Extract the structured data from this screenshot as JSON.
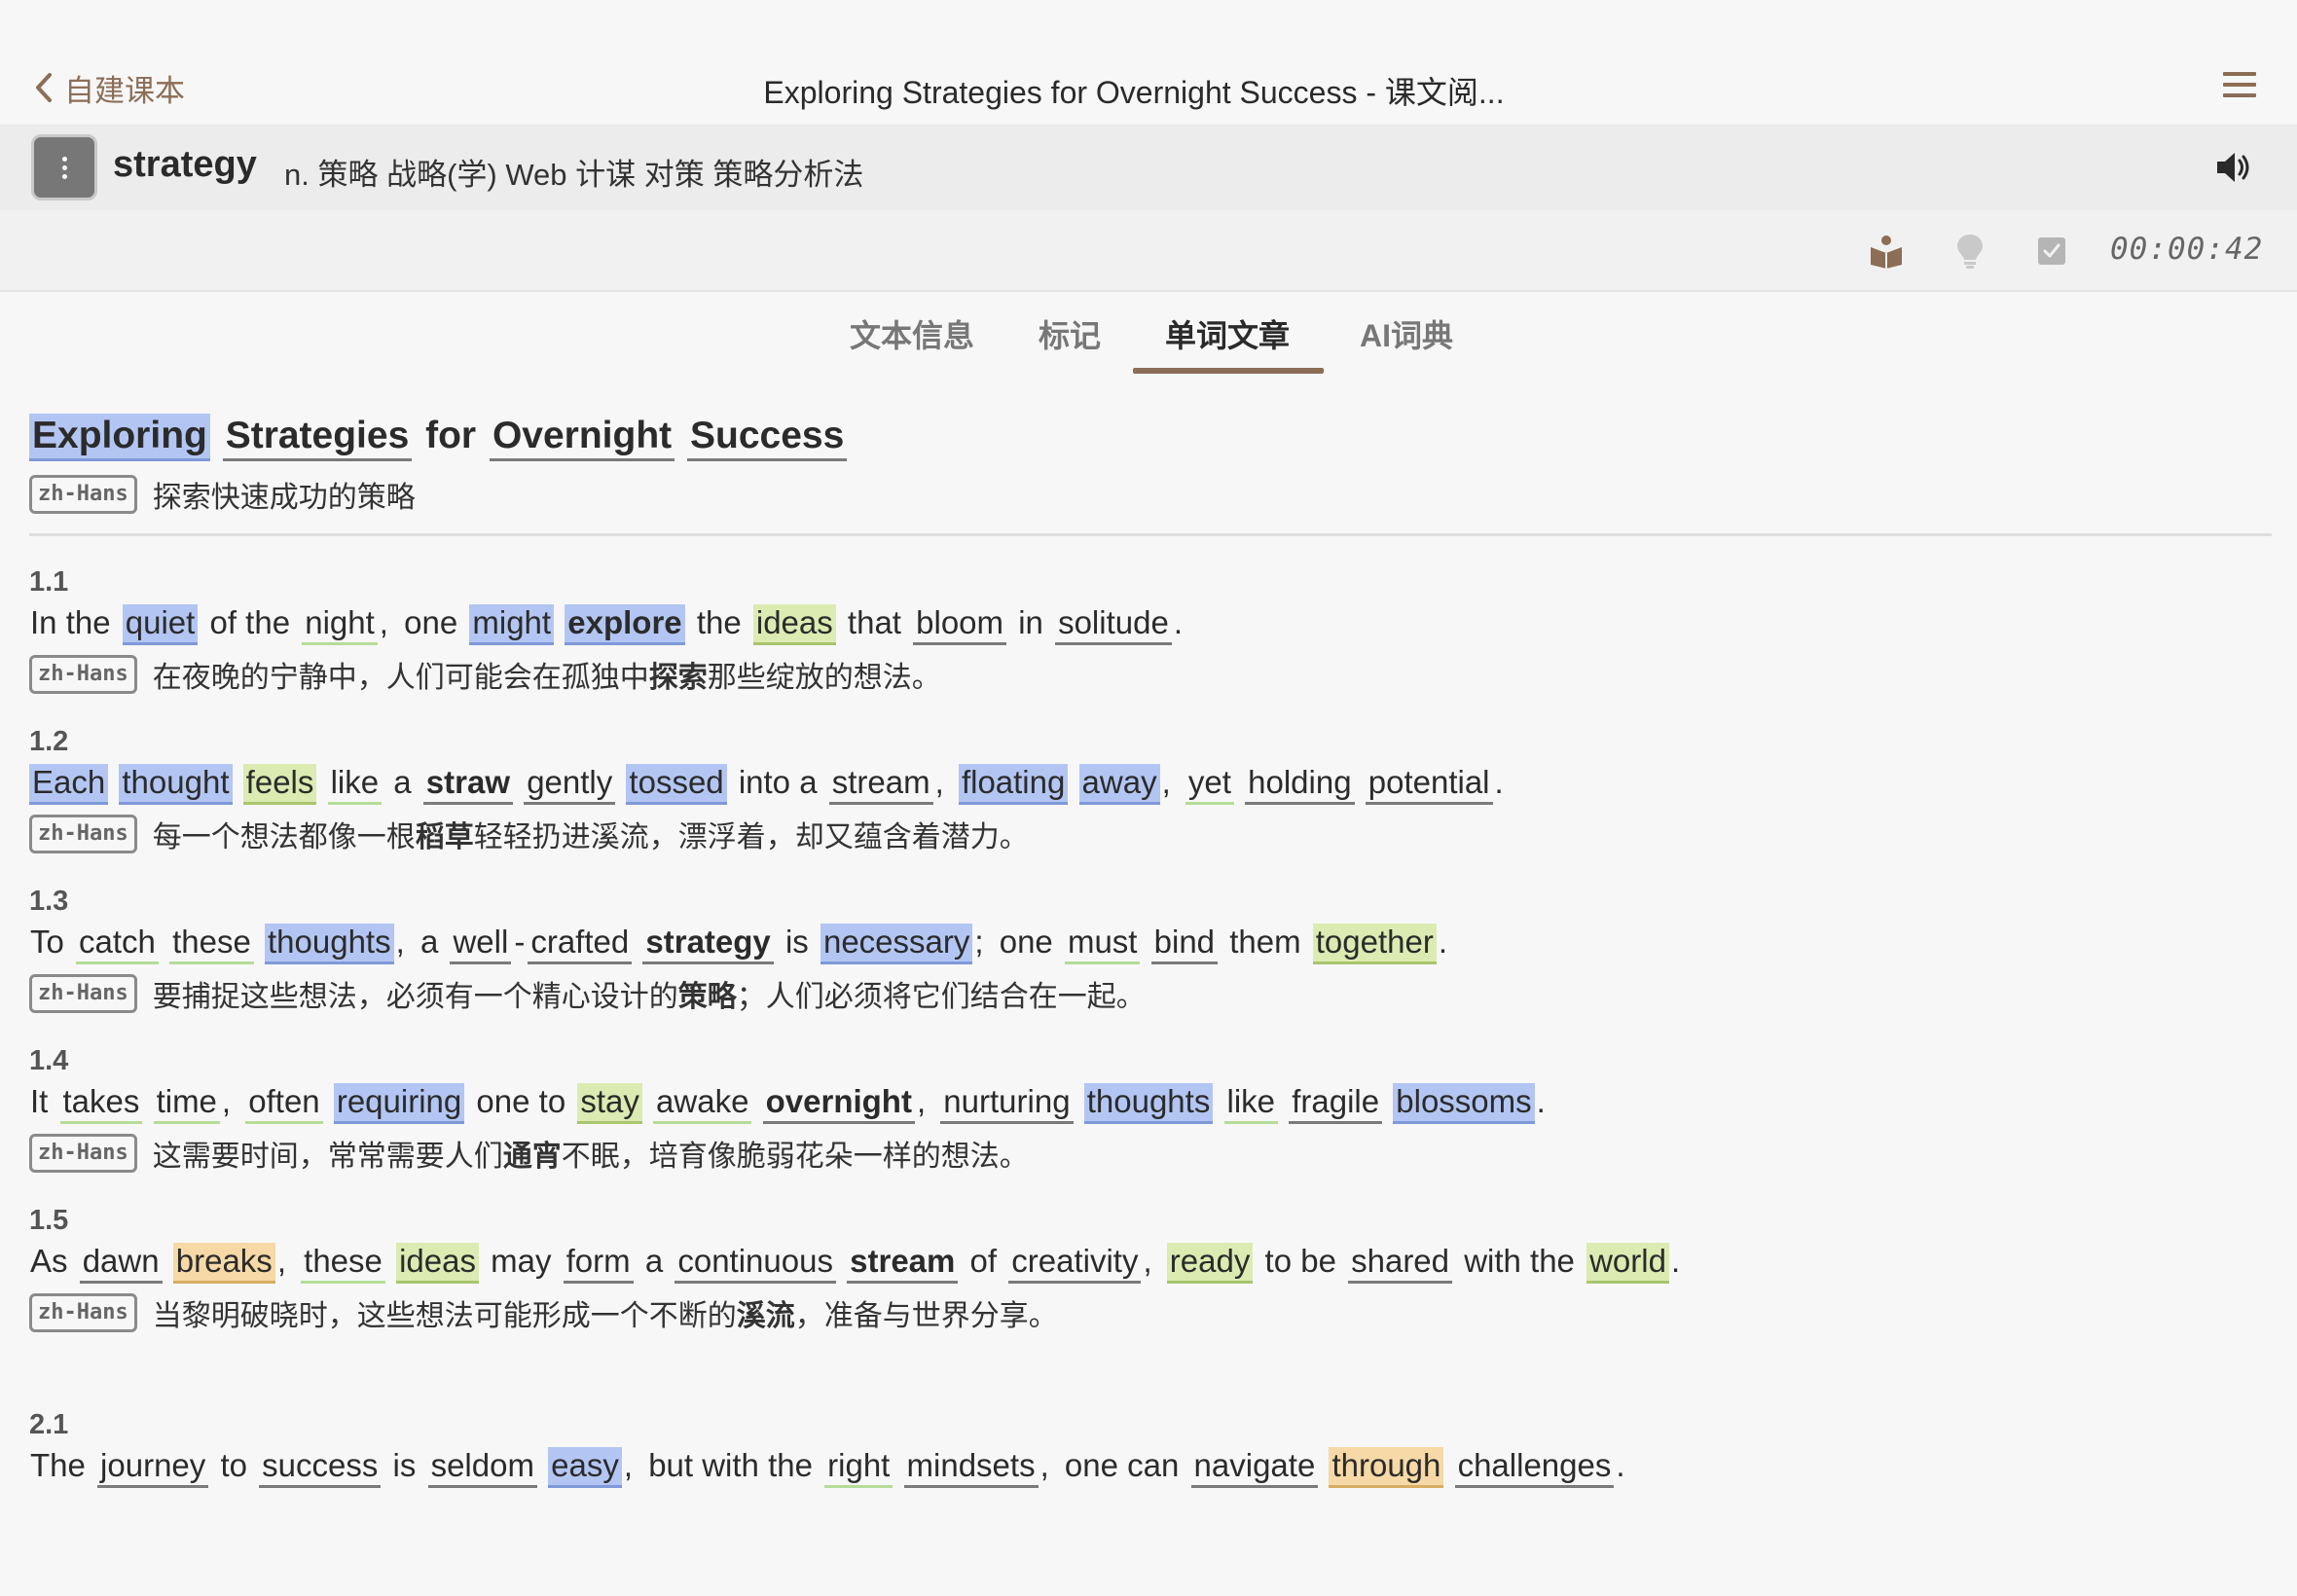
{
  "header": {
    "back_label": "自建课本",
    "title": "Exploring Strategies for Overnight Success - 课文阅..."
  },
  "word": {
    "headword": "strategy",
    "definition": "n. 策略 战略(学) Web 计谋 对策 策略分析法"
  },
  "toolbar": {
    "timer": "00:00:42"
  },
  "tabs": [
    "文本信息",
    "标记",
    "单词文章",
    "AI词典"
  ],
  "active_tab": "单词文章",
  "lang_tag": "zh-Hans",
  "article": {
    "title": [
      "Exploring",
      "Strategies",
      "for",
      "Overnight",
      "Success"
    ],
    "title_translation": "探索快速成功的策略",
    "sentences": [
      {
        "num": "1.1",
        "tokens": [
          "In the",
          "quiet",
          "of the",
          "night",
          ",",
          "one",
          "might",
          "explore",
          "the",
          "ideas",
          "that",
          "bloom",
          "in",
          "solitude",
          "."
        ],
        "translation": [
          "在夜晚的宁静中，人们可能会在孤独中",
          "探索",
          "那些绽放的想法。"
        ]
      },
      {
        "num": "1.2",
        "tokens": [
          "Each",
          "thought",
          "feels",
          "like",
          "a",
          "straw",
          "gently",
          "tossed",
          "into a",
          "stream",
          ",",
          "floating",
          "away",
          ",",
          "yet",
          "holding",
          "potential",
          "."
        ],
        "translation": [
          "每一个想法都像一根",
          "稻草",
          "轻轻扔进溪流，漂浮着，却又蕴含着潜力。"
        ]
      },
      {
        "num": "1.3",
        "tokens": [
          "To",
          "catch",
          "these",
          "thoughts",
          ",",
          "a",
          "well",
          "-",
          "crafted",
          "strategy",
          "is",
          "necessary",
          ";",
          "one",
          "must",
          "bind",
          "them",
          "together",
          "."
        ],
        "translation": [
          "要捕捉这些想法，必须有一个精心设计的",
          "策略",
          "；人们必须将它们结合在一起。"
        ]
      },
      {
        "num": "1.4",
        "tokens": [
          "It",
          "takes",
          "time",
          ",",
          "often",
          "requiring",
          "one to",
          "stay",
          "awake",
          "overnight",
          ",",
          "nurturing",
          "thoughts",
          "like",
          "fragile",
          "blossoms",
          "."
        ],
        "translation": [
          "这需要时间，常常需要人们",
          "通宵",
          "不眠，培育像脆弱花朵一样的想法。"
        ]
      },
      {
        "num": "1.5",
        "tokens": [
          "As",
          "dawn",
          "breaks",
          ",",
          "these",
          "ideas",
          "may",
          "form",
          "a",
          "continuous",
          "stream",
          "of",
          "creativity",
          ",",
          "ready",
          "to be",
          "shared",
          "with the",
          "world",
          "."
        ],
        "translation": [
          "当黎明破晓时，这些想法可能形成一个不断的",
          "溪流",
          "，准备与世界分享。"
        ]
      },
      {
        "num": "2.1",
        "tokens": [
          "The",
          "journey",
          "to",
          "success",
          "is",
          "seldom",
          "easy",
          ",",
          "but with the",
          "right",
          "mindsets",
          ",",
          "one can",
          "navigate",
          "through",
          "challenges",
          "."
        ],
        "translation": []
      }
    ]
  },
  "colors": {
    "accent": "#8c6d56",
    "highlight_blue": "#b3c6f3",
    "highlight_green": "#dcebb2",
    "highlight_orange": "#f6d9a6"
  },
  "icons": [
    "chevron-left-icon",
    "hamburger-menu-icon",
    "more-vertical-icon",
    "speaker-icon",
    "reader-icon",
    "lightbulb-icon",
    "checkbox-icon"
  ]
}
